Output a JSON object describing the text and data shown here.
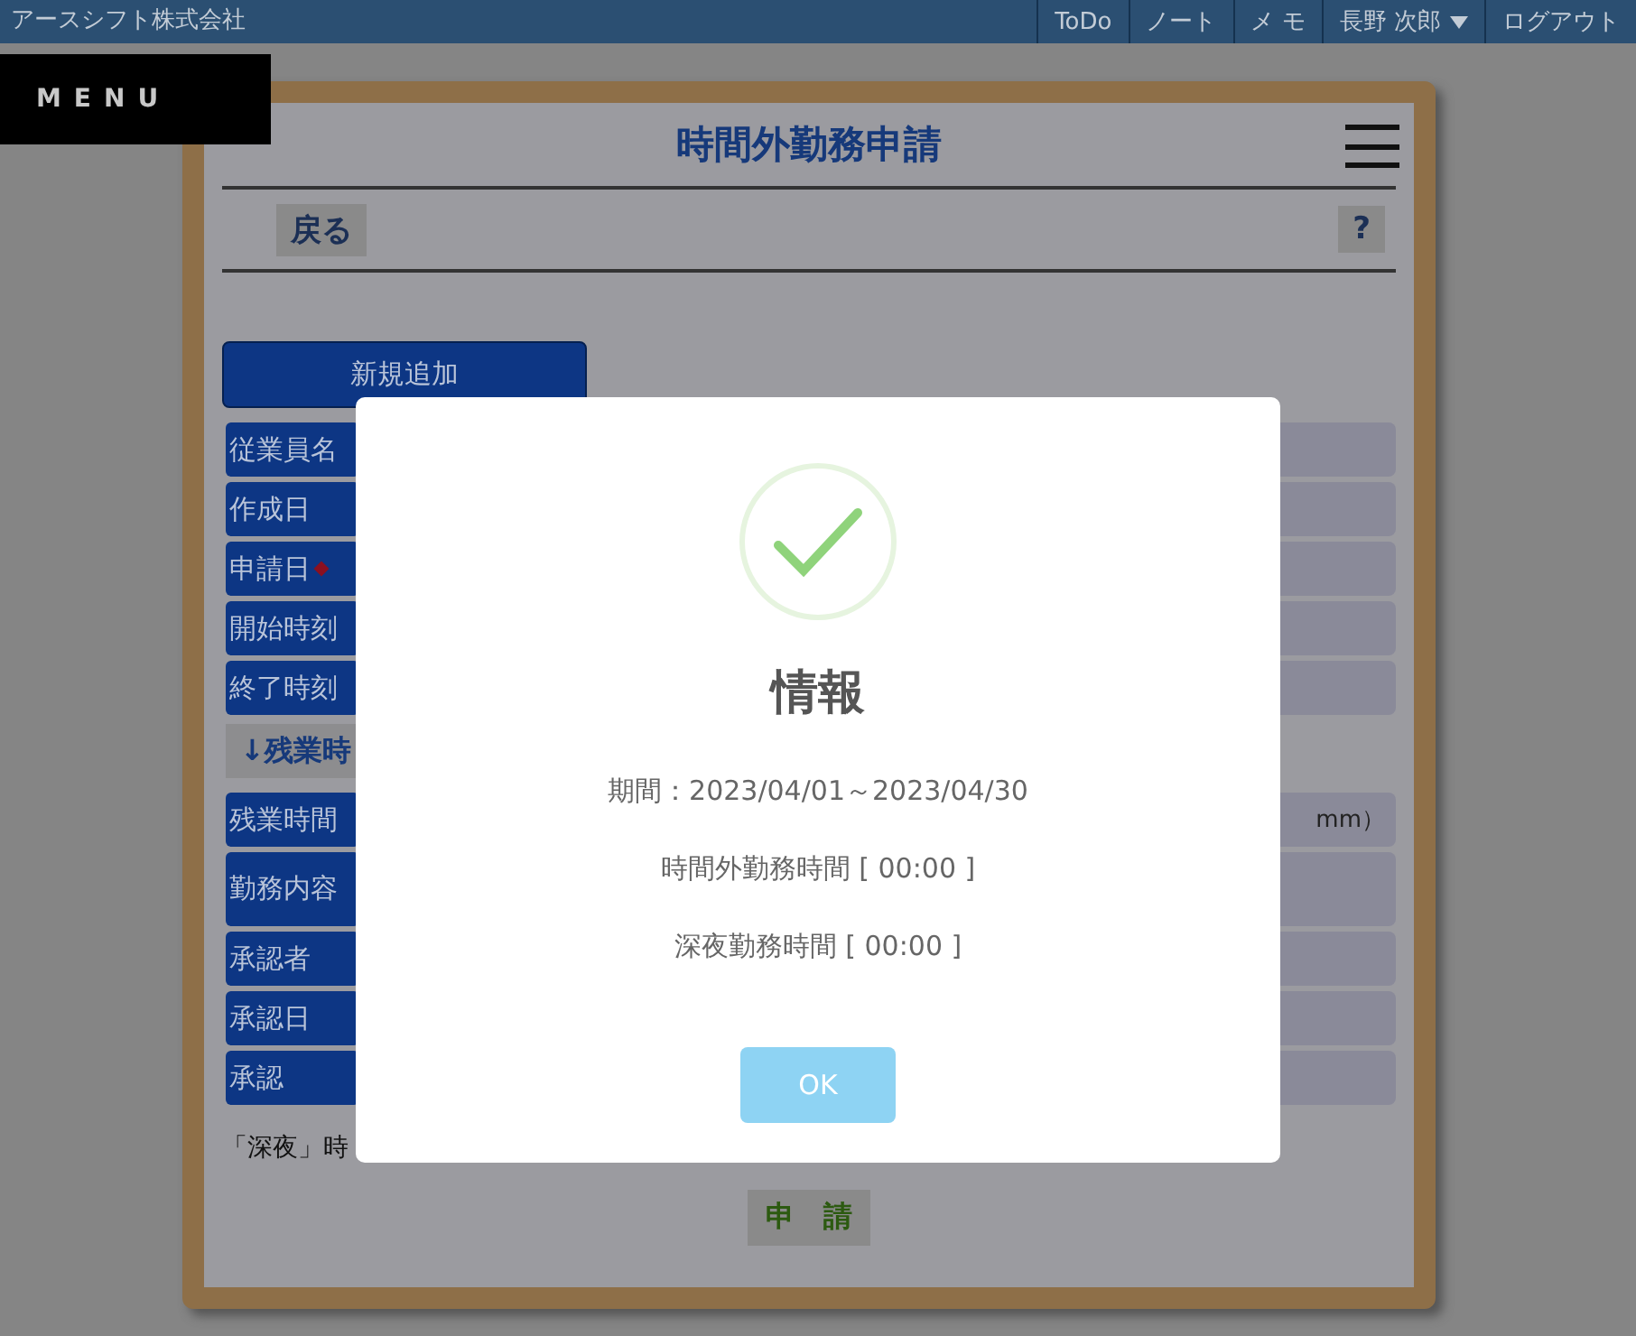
{
  "header": {
    "company": "アースシフト株式会社",
    "nav": [
      {
        "label": "ToDo",
        "kind": "link"
      },
      {
        "label": "ノート",
        "kind": "link"
      },
      {
        "label": "メ モ",
        "kind": "link"
      },
      {
        "label": "長野 次郎",
        "kind": "dropdown"
      },
      {
        "label": "ログアウト",
        "kind": "link"
      }
    ]
  },
  "menu_button": "MENU",
  "page": {
    "title": "時間外勤務申請",
    "back": "戻る",
    "help": "?",
    "add_button": "新規追加",
    "form": [
      {
        "kind": "field",
        "label": "従業員名",
        "required": false
      },
      {
        "kind": "field",
        "label": "作成日",
        "required": false
      },
      {
        "kind": "field",
        "label": "申請日",
        "required": true
      },
      {
        "kind": "field",
        "label": "開始時刻",
        "required": false
      },
      {
        "kind": "field",
        "label": "終了時刻",
        "required": false
      },
      {
        "kind": "section",
        "label": "↓残業時"
      },
      {
        "kind": "field",
        "label": "残業時間",
        "required": false,
        "hint": "mm）"
      },
      {
        "kind": "textarea",
        "label": "勤務内容",
        "required": false
      },
      {
        "kind": "field",
        "label": "承認者",
        "required": false
      },
      {
        "kind": "field",
        "label": "承認日",
        "required": false
      },
      {
        "kind": "field",
        "label": "承認",
        "required": false
      }
    ],
    "note": "「深夜」時",
    "submit": "申　請"
  },
  "dialog": {
    "title": "情報",
    "lines": [
      "期間：2023/04/01～2023/04/30",
      "時間外勤務時間 [ 00:00 ]",
      "深夜勤務時間 [ 00:00 ]"
    ],
    "ok": "OK"
  }
}
